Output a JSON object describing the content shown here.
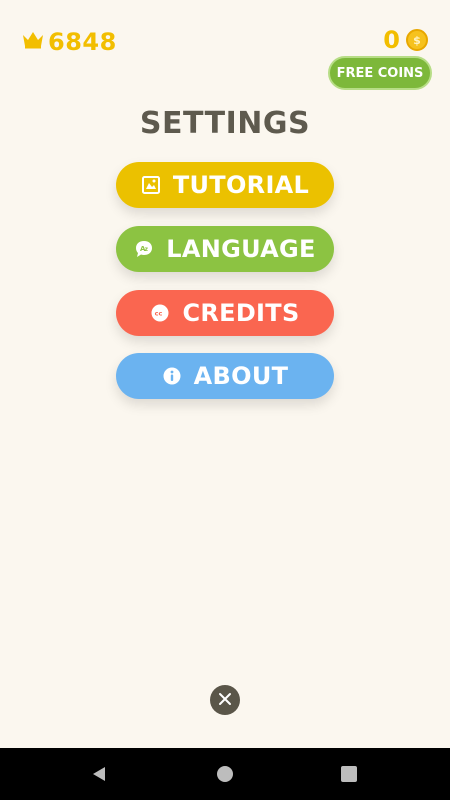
{
  "header": {
    "score": "6848",
    "score_icon": "crown-icon",
    "coins": "0",
    "coin_icon": "coin-icon",
    "free_coins_label": "FREE COINS"
  },
  "settings": {
    "title": "SETTINGS",
    "items": [
      {
        "label": "TUTORIAL",
        "icon": "tutorial-icon",
        "color": "#EBC100"
      },
      {
        "label": "LANGUAGE",
        "icon": "language-icon",
        "color": "#8CC342"
      },
      {
        "label": "CREDITS",
        "icon": "cc-icon",
        "color": "#FA6650"
      },
      {
        "label": "ABOUT",
        "icon": "info-icon",
        "color": "#6BB3F0"
      }
    ]
  },
  "close_icon": "close-icon",
  "navbar": {
    "back_icon": "back-icon",
    "home_icon": "home-icon",
    "recents_icon": "recents-icon"
  },
  "colors": {
    "background": "#FBF7EF",
    "gold": "#F2BE00",
    "free_coins_green": "#7DB83A",
    "title_text": "#5E5A4E"
  }
}
